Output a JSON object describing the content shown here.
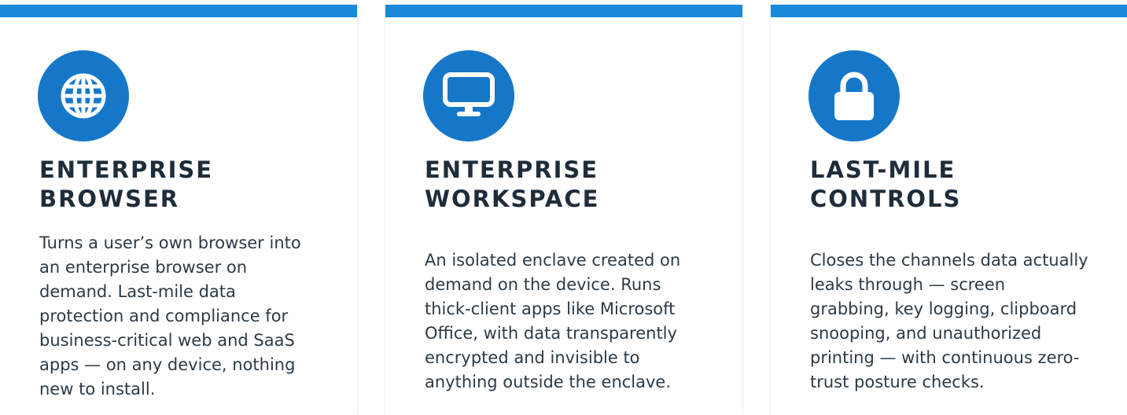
{
  "colors": {
    "accent": "#1a8ad8",
    "icon_circle": "#1677c9",
    "title": "#1f2d3a",
    "text": "#2c3a46"
  },
  "cards": [
    {
      "icon": "globe-icon",
      "title": "ENTERPRISE\nBROWSER",
      "description": "Turns a user’s own browser into an enterprise browser on demand. Last-mile data protection and compliance for business-critical web and SaaS apps — on any device, nothing new to install."
    },
    {
      "icon": "monitor-icon",
      "title": "ENTERPRISE\nWORKSPACE",
      "description": "An isolated enclave created on demand on the device. Runs thick-client apps like Microsoft Office, with data transparently encrypted and invisible to anything outside the enclave."
    },
    {
      "icon": "lock-icon",
      "title": "LAST-MILE\nCONTROLS",
      "description": "Closes the channels data actually leaks through — screen grabbing, key logging, clipboard snooping, and unauthorized printing — with continuous zero-trust posture checks."
    }
  ]
}
